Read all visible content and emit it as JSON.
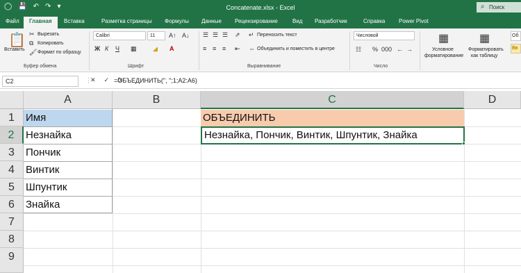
{
  "window": {
    "title": "Concatenate.xlsx - Excel",
    "search_label": "Поиск"
  },
  "tabs": [
    "Файл",
    "Главная",
    "Вставка",
    "Разметка страницы",
    "Формулы",
    "Данные",
    "Рецензирование",
    "Вид",
    "Разработчик",
    "Справка",
    "Power Pivot"
  ],
  "ribbon": {
    "clipboard": {
      "paste": "Вставить",
      "cut": "Вырезать",
      "copy": "Копировать",
      "format_painter": "Формат по образцу",
      "label": "Буфер обмена"
    },
    "font": {
      "name": "Calibri",
      "size": "11",
      "label": "Шрифт"
    },
    "alignment": {
      "wrap_text": "Переносить текст",
      "merge_center": "Объединить и поместить в центре",
      "label": "Выравнивание"
    },
    "number": {
      "format": "Числовой",
      "label": "Число"
    },
    "styles": {
      "conditional_line1": "Условное",
      "conditional_line2": "форматирование",
      "table_line1": "Форматировать",
      "table_line2": "как таблицу",
      "style_preview_top": "Об",
      "style_preview_bottom": "Вв"
    }
  },
  "formula_bar": {
    "name_box": "C2",
    "formula": "=ОБЪЕДИНИТЬ(\", \";1;A2:A6)"
  },
  "sheet": {
    "columns": [
      "A",
      "B",
      "C",
      "D"
    ],
    "rows": [
      "1",
      "2",
      "3",
      "4",
      "5",
      "6",
      "7",
      "8",
      "9"
    ],
    "cells": {
      "A1": "Имя",
      "A2": "Незнайка",
      "A3": "Пончик",
      "A4": "Винтик",
      "A5": "Шпунтик",
      "A6": "Знайка",
      "C1": "ОБЪЕДИНИТЬ",
      "C2": "Незнайка, Пончик, Винтик, Шпунтик, Знайка"
    },
    "colors": {
      "header_a1": "#bdd7ee",
      "header_c1": "#f8cbad",
      "accent": "#217346"
    }
  }
}
